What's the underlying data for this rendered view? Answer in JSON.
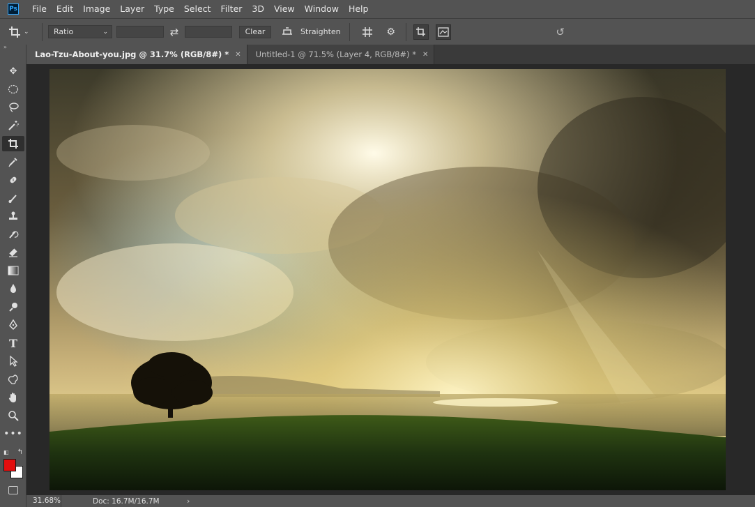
{
  "app": {
    "logo_text": "Ps"
  },
  "menu": [
    "File",
    "Edit",
    "Image",
    "Layer",
    "Type",
    "Select",
    "Filter",
    "3D",
    "View",
    "Window",
    "Help"
  ],
  "options": {
    "ratio_value": "Ratio",
    "clear_label": "Clear",
    "straighten_label": "Straighten"
  },
  "tabs": [
    {
      "label": "Lao-Tzu-About-you.jpg @ 31.7% (RGB/8#) *",
      "active": true
    },
    {
      "label": "Untitled-1 @ 71.5% (Layer 4, RGB/8#) *",
      "active": false
    }
  ],
  "tools": [
    "move-tool",
    "elliptical-marquee-tool",
    "lasso-tool",
    "magic-wand-tool",
    "crop-tool",
    "eyedropper-tool",
    "healing-brush-tool",
    "brush-tool",
    "clone-stamp-tool",
    "history-brush-tool",
    "eraser-tool",
    "gradient-tool",
    "blur-tool",
    "dodge-tool",
    "pen-tool",
    "type-tool",
    "path-selection-tool",
    "custom-shape-tool",
    "hand-tool",
    "zoom-tool",
    "more-tools"
  ],
  "colors": {
    "foreground": "#e30e0e",
    "background": "#ffffff"
  },
  "status": {
    "zoom": "31.68%",
    "doc": "Doc: 16.7M/16.7M",
    "arrow": "›"
  }
}
